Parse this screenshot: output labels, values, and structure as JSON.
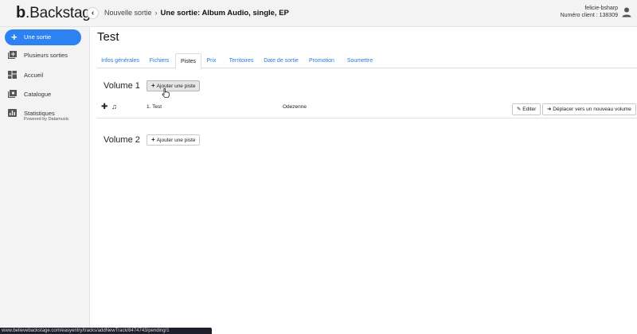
{
  "header": {
    "logo_letter": "b",
    "logo_text": "Backstage",
    "breadcrumb_parent": "Nouvelle sortie",
    "breadcrumb_separator": "›",
    "breadcrumb_current": "Une sortie: Album Audio, single, EP",
    "username": "felicie-bsharp",
    "client_number": "Numéro client : 138309"
  },
  "sidebar": {
    "new_button_label": "Une sortie",
    "items": [
      {
        "label": "Plusieurs sorties",
        "icon": "library-add-icon"
      },
      {
        "label": "Accueil",
        "icon": "dashboard-icon"
      },
      {
        "label": "Catalogue",
        "icon": "catalog-icon"
      },
      {
        "label": "Statistiques",
        "sub": "Powered by Datamusic",
        "icon": "stats-icon"
      }
    ]
  },
  "main": {
    "title": "Test",
    "tabs": [
      {
        "label": "Infos générales"
      },
      {
        "label": "Fichiers"
      },
      {
        "label": "Pistes",
        "active": true
      },
      {
        "label": "Prix"
      },
      {
        "label": "Territoires"
      },
      {
        "label": "Date de sortie"
      },
      {
        "label": "Promotion"
      },
      {
        "label": "Soumettre"
      }
    ],
    "volumes": [
      {
        "title": "Volume 1",
        "add_label": "Ajouter une piste",
        "tracks": [
          {
            "name": "1. Test",
            "artist": "Odezenne",
            "edit_label": "Editer",
            "move_label": "Déplacer vers un nouveau volume"
          }
        ]
      },
      {
        "title": "Volume 2",
        "add_label": "Ajouter une piste",
        "tracks": []
      }
    ]
  },
  "status_bar": {
    "url": "www.believebackstage.com/easyentry/tracks/addNewTrack/8474743/pending/1"
  },
  "colors": {
    "accent": "#2d81f0",
    "tab_link": "#2a7ad0",
    "sidebar_bg": "#f3f3f3"
  }
}
